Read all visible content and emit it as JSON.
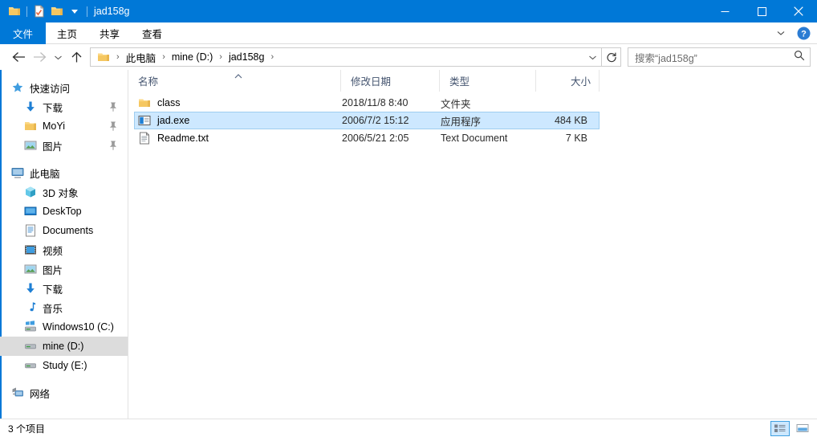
{
  "window": {
    "title": "jad158g",
    "quick_access": [
      {
        "name": "folder-icon",
        "label": "Folder"
      },
      {
        "name": "properties-icon",
        "label": "Properties"
      },
      {
        "name": "new-folder-icon",
        "label": "New folder"
      },
      {
        "name": "chevron-down-icon",
        "label": "Customize Quick Access Toolbar"
      }
    ],
    "controls": {
      "minimize": "–",
      "maximize": "□",
      "close": "✕"
    }
  },
  "ribbon": {
    "tabs": [
      {
        "label": "文件",
        "active": true
      },
      {
        "label": "主页",
        "active": false
      },
      {
        "label": "共享",
        "active": false
      },
      {
        "label": "查看",
        "active": false
      }
    ],
    "collapse_label": "Collapse Ribbon",
    "help_label": "?"
  },
  "address": {
    "back_label": "Back",
    "forward_label": "Forward",
    "recent_label": "Recent locations",
    "up_label": "Up",
    "breadcrumb": [
      "此电脑",
      "mine (D:)",
      "jad158g"
    ],
    "separator": "›",
    "dropdown_label": "Previous locations",
    "refresh_label": "Refresh"
  },
  "search": {
    "placeholder": "搜索“jad158g”"
  },
  "sidebar": {
    "items": [
      {
        "label": "快速访问",
        "icon": "star-icon",
        "level": "root",
        "pinned": false,
        "selected": false
      },
      {
        "label": "下载",
        "icon": "download-icon",
        "level": "child",
        "pinned": true,
        "selected": false
      },
      {
        "label": "MoYi",
        "icon": "folder-icon",
        "level": "child",
        "pinned": true,
        "selected": false
      },
      {
        "label": "图片",
        "icon": "pictures-icon",
        "level": "child",
        "pinned": true,
        "selected": false
      },
      {
        "label": "此电脑",
        "icon": "this-pc-icon",
        "level": "root",
        "pinned": false,
        "selected": false,
        "gap_before": true
      },
      {
        "label": "3D 对象",
        "icon": "3d-objects-icon",
        "level": "child",
        "pinned": false,
        "selected": false
      },
      {
        "label": "DeskTop",
        "icon": "desktop-icon",
        "level": "child",
        "pinned": false,
        "selected": false
      },
      {
        "label": "Documents",
        "icon": "documents-icon",
        "level": "child",
        "pinned": false,
        "selected": false
      },
      {
        "label": "视频",
        "icon": "videos-icon",
        "level": "child",
        "pinned": false,
        "selected": false
      },
      {
        "label": "图片",
        "icon": "pictures-icon",
        "level": "child",
        "pinned": false,
        "selected": false
      },
      {
        "label": "下载",
        "icon": "download-icon",
        "level": "child",
        "pinned": false,
        "selected": false
      },
      {
        "label": "音乐",
        "icon": "music-icon",
        "level": "child",
        "pinned": false,
        "selected": false
      },
      {
        "label": "Windows10 (C:)",
        "icon": "system-drive-icon",
        "level": "child",
        "pinned": false,
        "selected": false
      },
      {
        "label": "mine (D:)",
        "icon": "drive-icon",
        "level": "child",
        "pinned": false,
        "selected": true
      },
      {
        "label": "Study (E:)",
        "icon": "drive-icon",
        "level": "child",
        "pinned": false,
        "selected": false
      },
      {
        "label": "网络",
        "icon": "network-icon",
        "level": "root",
        "pinned": false,
        "selected": false,
        "gap_before": true
      }
    ]
  },
  "filelist": {
    "columns": [
      {
        "label": "名称",
        "sorted": "asc"
      },
      {
        "label": "修改日期",
        "sorted": ""
      },
      {
        "label": "类型",
        "sorted": ""
      },
      {
        "label": "大小",
        "sorted": ""
      }
    ],
    "rows": [
      {
        "name": "class",
        "date": "2018/11/8 8:40",
        "type": "文件夹",
        "size": "",
        "icon": "folder-icon",
        "selected": false
      },
      {
        "name": "jad.exe",
        "date": "2006/7/2 15:12",
        "type": "应用程序",
        "size": "484 KB",
        "icon": "application-icon",
        "selected": true
      },
      {
        "name": "Readme.txt",
        "date": "2006/5/21 2:05",
        "type": "Text Document",
        "size": "7 KB",
        "icon": "text-file-icon",
        "selected": false
      }
    ]
  },
  "statusbar": {
    "item_count": "3 个项目",
    "views": [
      {
        "name": "details-view-button",
        "active": true
      },
      {
        "name": "large-icons-view-button",
        "active": false
      }
    ]
  },
  "colors": {
    "accent": "#0078d7",
    "selection": "#cde8ff",
    "selection_border": "#9ecdf0",
    "nav_selection": "#dcdcdc",
    "column_header_text": "#44546f"
  }
}
